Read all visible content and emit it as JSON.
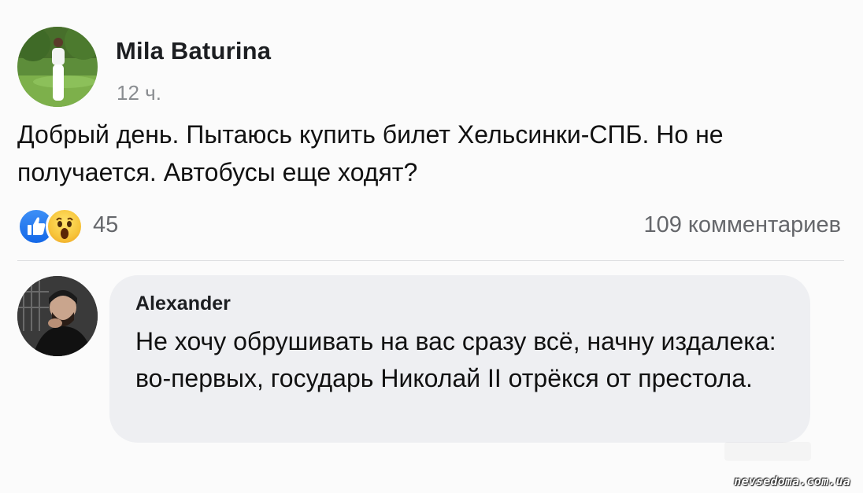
{
  "post": {
    "author": "Mila Baturina",
    "time": "12 ч.",
    "text": "Добрый день. Пытаюсь купить билет Хельсинки-СПБ. Но не получается. Автобусы еще ходят?",
    "reactions": {
      "icons": [
        "like-icon",
        "wow-icon"
      ],
      "count": "45"
    },
    "comments_count": "109 комментариев"
  },
  "comment": {
    "author": "Alexander",
    "text": "Не хочу обрушивать на вас сразу всё, начну издалека: во-первых, государь Николай II отрёкся от престола."
  },
  "watermark": "nevsedoma.com.ua",
  "colors": {
    "like_blue": "#1877f2",
    "wow_yellow": "#f7c43a",
    "bubble_bg": "#eeeff2",
    "secondary_text": "#65676b"
  }
}
